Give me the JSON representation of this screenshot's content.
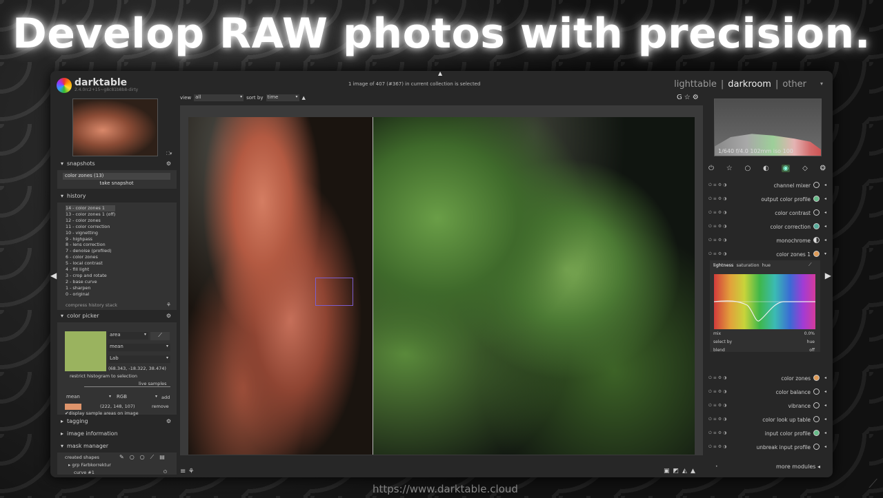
{
  "headline": "Develop RAW photos with precision.",
  "url": "https://www.darktable.cloud",
  "app": {
    "name": "darktable",
    "version": "2.4.0rc2+15~g8c81b8b8-dirty"
  },
  "status": "1 image of 407 (#367) in current collection is selected",
  "views": {
    "lighttable": "lighttable",
    "sep": "|",
    "darkroom": "darkroom",
    "other": "other"
  },
  "toolbar": {
    "view_label": "view",
    "view_value": "all",
    "sort_label": "sort by",
    "sort_value": "time",
    "sort_dir": "▲"
  },
  "snapshots": {
    "title": "snapshots",
    "item": "color zones (13)",
    "button": "take snapshot"
  },
  "history": {
    "title": "history",
    "items": [
      "14 - color zones 1",
      "13 - color zones 1 (off)",
      "12 - color zones",
      "11 - color correction",
      "10 - vignetting",
      "9 - highpass",
      "8 - lens correction",
      "7 - denoise (profiled)",
      "6 - color zones",
      "5 - local contrast",
      "4 - fill light",
      "3 - crop and rotate",
      "2 - base curve",
      "1 - sharpen",
      "0 - original"
    ],
    "compress": "compress history stack"
  },
  "color_picker": {
    "title": "color picker",
    "mode": "area",
    "stat": "mean",
    "space": "Lab",
    "value": "(68.343, -18.322, 38.474)",
    "restrict": "restrict histogram to selection",
    "live": "live samples",
    "sample_stat": "mean",
    "sample_space": "RGB",
    "add": "add",
    "sample_value": "(222, 148, 107)",
    "remove": "remove",
    "display": "display sample areas on image",
    "swatch_color": "#9ab35f",
    "sample_color": "#de946b"
  },
  "tagging": {
    "title": "tagging"
  },
  "image_information": {
    "title": "image information"
  },
  "mask_manager": {
    "title": "mask manager",
    "created": "created shapes",
    "group": "grp Farbkorrektur",
    "curve": "curve #1"
  },
  "histogram": {
    "info": "1/640 f/4.0 102mm iso 100"
  },
  "modules": [
    {
      "label": "channel mixer"
    },
    {
      "label": "output color profile"
    },
    {
      "label": "color contrast"
    },
    {
      "label": "color correction"
    },
    {
      "label": "monochrome"
    },
    {
      "label": "color zones 1"
    },
    {
      "label": "color zones"
    },
    {
      "label": "color balance"
    },
    {
      "label": "vibrance"
    },
    {
      "label": "color look up table"
    },
    {
      "label": "input color profile"
    },
    {
      "label": "unbreak input profile"
    }
  ],
  "colorzones": {
    "tab_lightness": "lightness",
    "tab_saturation": "saturation",
    "tab_hue": "hue",
    "mix_label": "mix",
    "mix_value": "0.0%",
    "select_label": "select by",
    "select_value": "hue",
    "blend_label": "blend",
    "blend_value": "off"
  },
  "more_modules": "more modules"
}
